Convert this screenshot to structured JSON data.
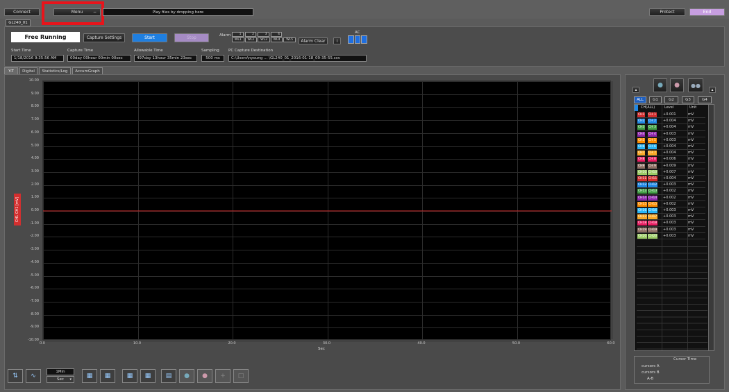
{
  "topbar": {
    "connect": "Connect",
    "menu": "Menu",
    "drop_hint": "Play files by dropping here",
    "protect": "Protect",
    "end": "End"
  },
  "device_tab": "GL240_01",
  "status": {
    "mode": "Free Running",
    "capture_settings": "Capture Settings",
    "start": "Start",
    "stop": "Stop",
    "alarm_label": "Alarm",
    "alarm_top": [
      "1",
      "2",
      "3",
      "4"
    ],
    "alarm_bottom": [
      "WL1",
      "WL2",
      "WL3",
      "WL4",
      "WL5"
    ],
    "alarm_clear": "Alarm Clear",
    "info": "i",
    "ac": "AC"
  },
  "info": {
    "start_time_label": "Start Time",
    "start_time": "1/18/2016 9:35:56 AM",
    "capture_time_label": "Capture Time",
    "capture_time": "00day 00hour 00min 00sec",
    "allowable_time_label": "Allowable Time",
    "allowable_time": "497day 13hour 35min 23sec",
    "sampling_label": "Sampling",
    "sampling": "500 ms",
    "dest_label": "PC Capture Destination",
    "dest": "C:\\Users\\nyoung ... \\GL240_01_2016-01-18_09-35-55.csv"
  },
  "tabs": [
    "Y-T",
    "Digital",
    "Statistics/Log",
    "AccumGraph"
  ],
  "chart_data": {
    "type": "line",
    "xlabel": "Sec",
    "ylabel": "CH1 CH1 [mV]",
    "xlim": [
      0,
      60
    ],
    "ylim": [
      -10,
      10
    ],
    "x_ticks": [
      "0.0",
      "10.0",
      "20.0",
      "30.0",
      "40.0",
      "50.0",
      "60.0"
    ],
    "y_ticks": [
      "10.00",
      "9.00",
      "8.00",
      "7.00",
      "6.00",
      "5.00",
      "4.00",
      "3.00",
      "2.00",
      "1.00",
      "0.00",
      "-1.00",
      "-2.00",
      "-3.00",
      "-4.00",
      "-5.00",
      "-6.00",
      "-7.00",
      "-8.00",
      "-9.00",
      "-10.00"
    ],
    "series": [
      {
        "name": "CH1 CH1",
        "color": "#d32f2f",
        "x": [
          0,
          60
        ],
        "y": [
          0.0,
          0.0
        ]
      }
    ],
    "grid": true
  },
  "bottom_toolbar": {
    "span_value": "1Min",
    "span_unit": "Sec"
  },
  "right_panel": {
    "groups": [
      "ALL",
      "G1",
      "G2",
      "G3",
      "G4"
    ],
    "headers": [
      "CH(ALL)",
      "Level",
      "Unit"
    ],
    "channels": [
      {
        "a": "CH1",
        "b": "CH 1",
        "level": "+0.001",
        "unit": "mV",
        "color": "#d32f2f"
      },
      {
        "a": "CH2",
        "b": "CH 2",
        "level": "+0.004",
        "unit": "mV",
        "color": "#1e88e5"
      },
      {
        "a": "CH3",
        "b": "CH 3",
        "level": "+0.004",
        "unit": "mV",
        "color": "#43a047"
      },
      {
        "a": "CH4",
        "b": "CH 4",
        "level": "+0.003",
        "unit": "mV",
        "color": "#8e24aa"
      },
      {
        "a": "CH5",
        "b": "CH 5",
        "level": "+0.003",
        "unit": "mV",
        "color": "#fb8c00"
      },
      {
        "a": "CH6",
        "b": "CH 6",
        "level": "+0.004",
        "unit": "mV",
        "color": "#29b6f6"
      },
      {
        "a": "CH7",
        "b": "CH 7",
        "level": "+0.004",
        "unit": "mV",
        "color": "#f9a825"
      },
      {
        "a": "CH8",
        "b": "CH 8",
        "level": "+0.006",
        "unit": "mV",
        "color": "#e91e63"
      },
      {
        "a": "CH9",
        "b": "CH 9",
        "level": "+0.009",
        "unit": "mV",
        "color": "#8d6e63"
      },
      {
        "a": "CH10",
        "b": "CH10",
        "level": "+0.007",
        "unit": "mV",
        "color": "#9ccc65"
      },
      {
        "a": "CH11",
        "b": "CH11",
        "level": "+0.004",
        "unit": "mV",
        "color": "#d32f2f"
      },
      {
        "a": "CH12",
        "b": "CH12",
        "level": "+0.003",
        "unit": "mV",
        "color": "#1e88e5"
      },
      {
        "a": "CH13",
        "b": "CH13",
        "level": "+0.002",
        "unit": "mV",
        "color": "#43a047"
      },
      {
        "a": "CH14",
        "b": "CH14",
        "level": "+0.002",
        "unit": "mV",
        "color": "#8e24aa"
      },
      {
        "a": "CH15",
        "b": "CH15",
        "level": "+0.002",
        "unit": "mV",
        "color": "#fb8c00"
      },
      {
        "a": "CH16",
        "b": "CH16",
        "level": "+0.003",
        "unit": "mV",
        "color": "#29b6f6"
      },
      {
        "a": "CH17",
        "b": "CH17",
        "level": "+0.003",
        "unit": "mV",
        "color": "#f9a825"
      },
      {
        "a": "CH18",
        "b": "CH18",
        "level": "+0.003",
        "unit": "mV",
        "color": "#e91e63"
      },
      {
        "a": "CH19",
        "b": "CH19",
        "level": "+0.003",
        "unit": "mV",
        "color": "#8d6e63"
      },
      {
        "a": "CH20",
        "b": "CH20",
        "level": "+0.003",
        "unit": "mV",
        "color": "#9ccc65"
      }
    ],
    "cursor_header": "Cursor Time",
    "cursor_rows": [
      "cursors A",
      "cursors B",
      "A-B"
    ]
  },
  "highlight_color": "#e8141b"
}
